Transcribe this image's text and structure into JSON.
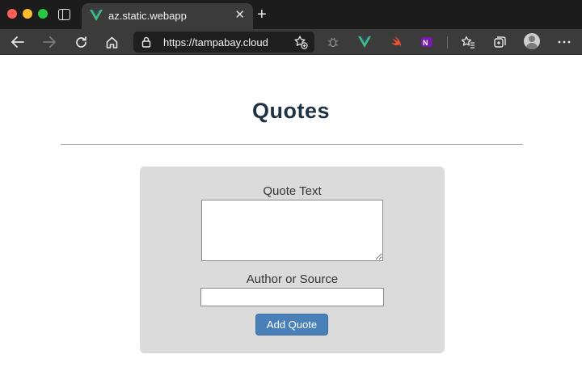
{
  "browser": {
    "tab": {
      "title": "az.static.webapp",
      "favicon": "vue-logo-icon"
    },
    "address": {
      "url": "https://tampabay.cloud"
    },
    "accent": "#42b883"
  },
  "page": {
    "title": "Quotes",
    "form": {
      "quote_label": "Quote Text",
      "quote_value": "",
      "author_label": "Author or Source",
      "author_value": "",
      "submit_label": "Add Quote"
    }
  },
  "colors": {
    "title": "#1f3346",
    "card_bg": "#dcdbdc",
    "button_bg": "#4a80b8"
  }
}
